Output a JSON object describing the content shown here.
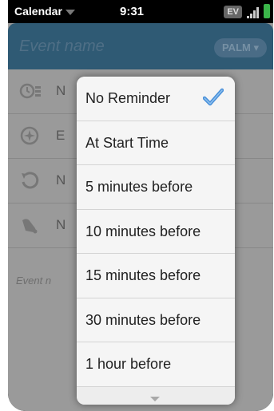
{
  "status_bar": {
    "app_name": "Calendar",
    "time": "9:31",
    "carrier_badge": "EV"
  },
  "header": {
    "event_name_placeholder": "Event name",
    "calendar_label": "PALM"
  },
  "rows": [
    {
      "icon": "alarm-icon",
      "text": "N"
    },
    {
      "icon": "compass-icon",
      "text": "E"
    },
    {
      "icon": "repeat-icon",
      "text": "N"
    },
    {
      "icon": "bell-icon",
      "text": "N"
    }
  ],
  "notes_placeholder": "Event n",
  "reminder_menu": {
    "items": [
      {
        "label": "No Reminder",
        "selected": true
      },
      {
        "label": "At Start Time",
        "selected": false
      },
      {
        "label": "5 minutes before",
        "selected": false
      },
      {
        "label": "10 minutes before",
        "selected": false
      },
      {
        "label": "15 minutes before",
        "selected": false
      },
      {
        "label": "30 minutes before",
        "selected": false
      },
      {
        "label": "1 hour before",
        "selected": false
      }
    ],
    "check_color": "#4a90d9"
  },
  "colors": {
    "header_bg": "#2f5a74",
    "overlay_bg": "#9a9a9a",
    "menu_bg": "#f4f4f4",
    "battery": "#3bb54a"
  }
}
